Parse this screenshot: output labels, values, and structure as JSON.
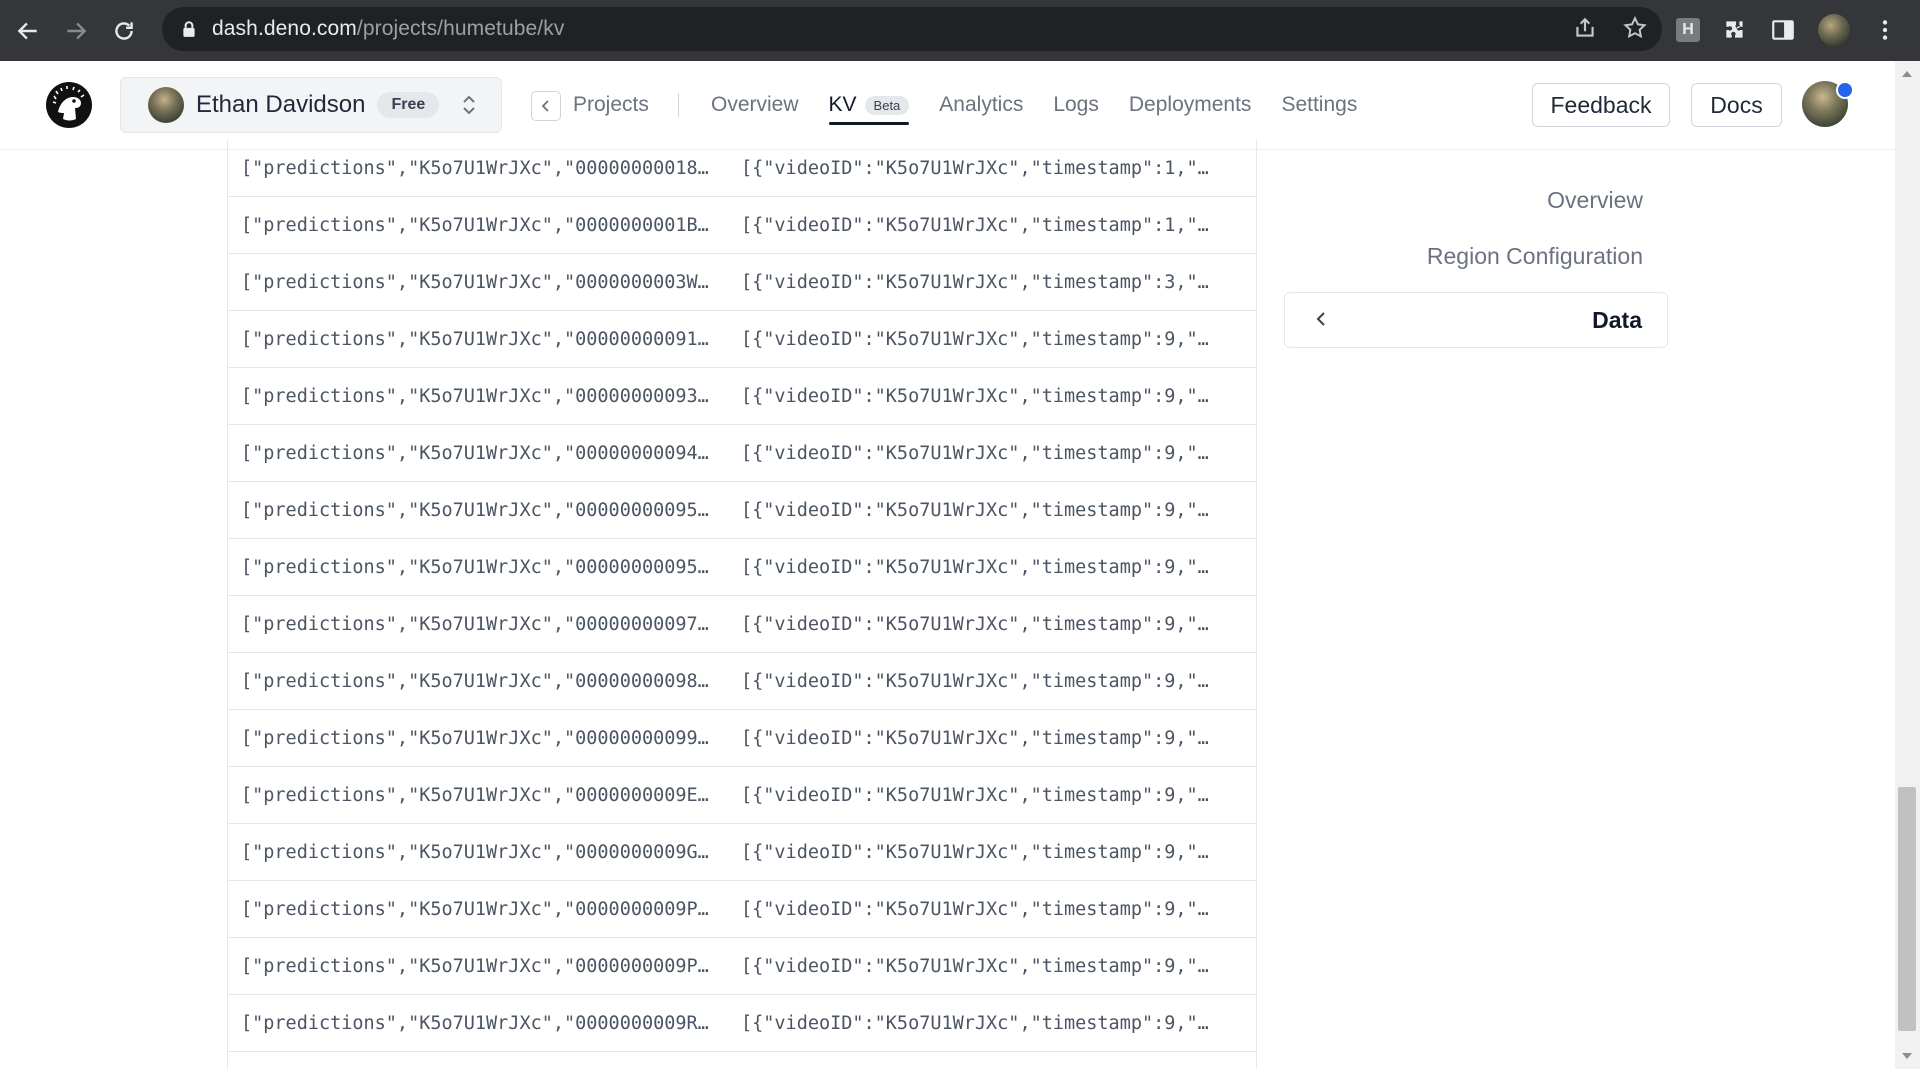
{
  "browser": {
    "url_host": "dash.deno.com",
    "url_path": "/projects/humetube/kv",
    "extension_label": "H"
  },
  "header": {
    "org_name": "Ethan Davidson",
    "plan": "Free",
    "projects_label": "Projects",
    "tabs": [
      {
        "label": "Overview"
      },
      {
        "label": "KV",
        "badge": "Beta"
      },
      {
        "label": "Analytics"
      },
      {
        "label": "Logs"
      },
      {
        "label": "Deployments"
      },
      {
        "label": "Settings"
      }
    ],
    "feedback_label": "Feedback",
    "docs_label": "Docs"
  },
  "table": {
    "rows": [
      {
        "key": "[\"predictions\",\"K5o7U1WrJXc\",\"00000000018…",
        "value": "[{\"videoID\":\"K5o7U1WrJXc\",\"timestamp\":1,\"…"
      },
      {
        "key": "[\"predictions\",\"K5o7U1WrJXc\",\"0000000001B…",
        "value": "[{\"videoID\":\"K5o7U1WrJXc\",\"timestamp\":1,\"…"
      },
      {
        "key": "[\"predictions\",\"K5o7U1WrJXc\",\"0000000003W…",
        "value": "[{\"videoID\":\"K5o7U1WrJXc\",\"timestamp\":3,\"…"
      },
      {
        "key": "[\"predictions\",\"K5o7U1WrJXc\",\"00000000091…",
        "value": "[{\"videoID\":\"K5o7U1WrJXc\",\"timestamp\":9,\"…"
      },
      {
        "key": "[\"predictions\",\"K5o7U1WrJXc\",\"00000000093…",
        "value": "[{\"videoID\":\"K5o7U1WrJXc\",\"timestamp\":9,\"…"
      },
      {
        "key": "[\"predictions\",\"K5o7U1WrJXc\",\"00000000094…",
        "value": "[{\"videoID\":\"K5o7U1WrJXc\",\"timestamp\":9,\"…"
      },
      {
        "key": "[\"predictions\",\"K5o7U1WrJXc\",\"00000000095…",
        "value": "[{\"videoID\":\"K5o7U1WrJXc\",\"timestamp\":9,\"…"
      },
      {
        "key": "[\"predictions\",\"K5o7U1WrJXc\",\"00000000095…",
        "value": "[{\"videoID\":\"K5o7U1WrJXc\",\"timestamp\":9,\"…"
      },
      {
        "key": "[\"predictions\",\"K5o7U1WrJXc\",\"00000000097…",
        "value": "[{\"videoID\":\"K5o7U1WrJXc\",\"timestamp\":9,\"…"
      },
      {
        "key": "[\"predictions\",\"K5o7U1WrJXc\",\"00000000098…",
        "value": "[{\"videoID\":\"K5o7U1WrJXc\",\"timestamp\":9,\"…"
      },
      {
        "key": "[\"predictions\",\"K5o7U1WrJXc\",\"00000000099…",
        "value": "[{\"videoID\":\"K5o7U1WrJXc\",\"timestamp\":9,\"…"
      },
      {
        "key": "[\"predictions\",\"K5o7U1WrJXc\",\"0000000009E…",
        "value": "[{\"videoID\":\"K5o7U1WrJXc\",\"timestamp\":9,\"…"
      },
      {
        "key": "[\"predictions\",\"K5o7U1WrJXc\",\"0000000009G…",
        "value": "[{\"videoID\":\"K5o7U1WrJXc\",\"timestamp\":9,\"…"
      },
      {
        "key": "[\"predictions\",\"K5o7U1WrJXc\",\"0000000009P…",
        "value": "[{\"videoID\":\"K5o7U1WrJXc\",\"timestamp\":9,\"…"
      },
      {
        "key": "[\"predictions\",\"K5o7U1WrJXc\",\"0000000009P…",
        "value": "[{\"videoID\":\"K5o7U1WrJXc\",\"timestamp\":9,\"…"
      },
      {
        "key": "[\"predictions\",\"K5o7U1WrJXc\",\"0000000009R…",
        "value": "[{\"videoID\":\"K5o7U1WrJXc\",\"timestamp\":9,\"…"
      },
      {
        "key": "",
        "value": ""
      }
    ]
  },
  "side_nav": {
    "items": [
      {
        "label": "Overview"
      },
      {
        "label": "Region Configuration"
      }
    ],
    "active": "Data"
  },
  "colors": {
    "accent": "#2563eb",
    "chrome_bg": "#35363a",
    "omnibox_bg": "#202124"
  }
}
